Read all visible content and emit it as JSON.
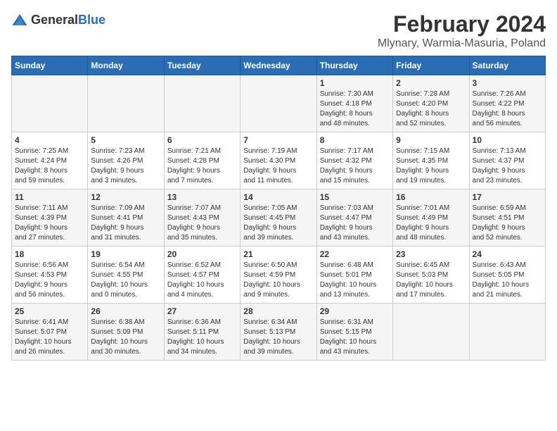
{
  "logo": {
    "general": "General",
    "blue": "Blue"
  },
  "title": "February 2024",
  "subtitle": "Mlynary, Warmia-Masuria, Poland",
  "weekdays": [
    "Sunday",
    "Monday",
    "Tuesday",
    "Wednesday",
    "Thursday",
    "Friday",
    "Saturday"
  ],
  "weeks": [
    [
      {
        "day": "",
        "info": ""
      },
      {
        "day": "",
        "info": ""
      },
      {
        "day": "",
        "info": ""
      },
      {
        "day": "",
        "info": ""
      },
      {
        "day": "1",
        "info": "Sunrise: 7:30 AM\nSunset: 4:18 PM\nDaylight: 8 hours\nand 48 minutes."
      },
      {
        "day": "2",
        "info": "Sunrise: 7:28 AM\nSunset: 4:20 PM\nDaylight: 8 hours\nand 52 minutes."
      },
      {
        "day": "3",
        "info": "Sunrise: 7:26 AM\nSunset: 4:22 PM\nDaylight: 8 hours\nand 56 minutes."
      }
    ],
    [
      {
        "day": "4",
        "info": "Sunrise: 7:25 AM\nSunset: 4:24 PM\nDaylight: 8 hours\nand 59 minutes."
      },
      {
        "day": "5",
        "info": "Sunrise: 7:23 AM\nSunset: 4:26 PM\nDaylight: 9 hours\nand 3 minutes."
      },
      {
        "day": "6",
        "info": "Sunrise: 7:21 AM\nSunset: 4:28 PM\nDaylight: 9 hours\nand 7 minutes."
      },
      {
        "day": "7",
        "info": "Sunrise: 7:19 AM\nSunset: 4:30 PM\nDaylight: 9 hours\nand 11 minutes."
      },
      {
        "day": "8",
        "info": "Sunrise: 7:17 AM\nSunset: 4:32 PM\nDaylight: 9 hours\nand 15 minutes."
      },
      {
        "day": "9",
        "info": "Sunrise: 7:15 AM\nSunset: 4:35 PM\nDaylight: 9 hours\nand 19 minutes."
      },
      {
        "day": "10",
        "info": "Sunrise: 7:13 AM\nSunset: 4:37 PM\nDaylight: 9 hours\nand 23 minutes."
      }
    ],
    [
      {
        "day": "11",
        "info": "Sunrise: 7:11 AM\nSunset: 4:39 PM\nDaylight: 9 hours\nand 27 minutes."
      },
      {
        "day": "12",
        "info": "Sunrise: 7:09 AM\nSunset: 4:41 PM\nDaylight: 9 hours\nand 31 minutes."
      },
      {
        "day": "13",
        "info": "Sunrise: 7:07 AM\nSunset: 4:43 PM\nDaylight: 9 hours\nand 35 minutes."
      },
      {
        "day": "14",
        "info": "Sunrise: 7:05 AM\nSunset: 4:45 PM\nDaylight: 9 hours\nand 39 minutes."
      },
      {
        "day": "15",
        "info": "Sunrise: 7:03 AM\nSunset: 4:47 PM\nDaylight: 9 hours\nand 43 minutes."
      },
      {
        "day": "16",
        "info": "Sunrise: 7:01 AM\nSunset: 4:49 PM\nDaylight: 9 hours\nand 48 minutes."
      },
      {
        "day": "17",
        "info": "Sunrise: 6:59 AM\nSunset: 4:51 PM\nDaylight: 9 hours\nand 52 minutes."
      }
    ],
    [
      {
        "day": "18",
        "info": "Sunrise: 6:56 AM\nSunset: 4:53 PM\nDaylight: 9 hours\nand 56 minutes."
      },
      {
        "day": "19",
        "info": "Sunrise: 6:54 AM\nSunset: 4:55 PM\nDaylight: 10 hours\nand 0 minutes."
      },
      {
        "day": "20",
        "info": "Sunrise: 6:52 AM\nSunset: 4:57 PM\nDaylight: 10 hours\nand 4 minutes."
      },
      {
        "day": "21",
        "info": "Sunrise: 6:50 AM\nSunset: 4:59 PM\nDaylight: 10 hours\nand 9 minutes."
      },
      {
        "day": "22",
        "info": "Sunrise: 6:48 AM\nSunset: 5:01 PM\nDaylight: 10 hours\nand 13 minutes."
      },
      {
        "day": "23",
        "info": "Sunrise: 6:45 AM\nSunset: 5:03 PM\nDaylight: 10 hours\nand 17 minutes."
      },
      {
        "day": "24",
        "info": "Sunrise: 6:43 AM\nSunset: 5:05 PM\nDaylight: 10 hours\nand 21 minutes."
      }
    ],
    [
      {
        "day": "25",
        "info": "Sunrise: 6:41 AM\nSunset: 5:07 PM\nDaylight: 10 hours\nand 26 minutes."
      },
      {
        "day": "26",
        "info": "Sunrise: 6:38 AM\nSunset: 5:09 PM\nDaylight: 10 hours\nand 30 minutes."
      },
      {
        "day": "27",
        "info": "Sunrise: 6:36 AM\nSunset: 5:11 PM\nDaylight: 10 hours\nand 34 minutes."
      },
      {
        "day": "28",
        "info": "Sunrise: 6:34 AM\nSunset: 5:13 PM\nDaylight: 10 hours\nand 39 minutes."
      },
      {
        "day": "29",
        "info": "Sunrise: 6:31 AM\nSunset: 5:15 PM\nDaylight: 10 hours\nand 43 minutes."
      },
      {
        "day": "",
        "info": ""
      },
      {
        "day": "",
        "info": ""
      }
    ]
  ]
}
